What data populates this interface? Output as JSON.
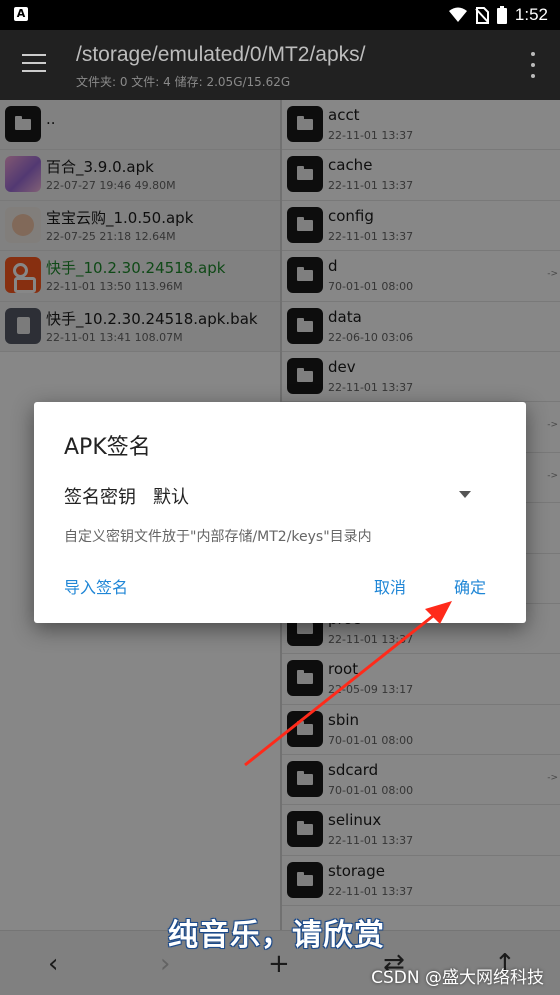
{
  "status_bar": {
    "time": "1:52"
  },
  "toolbar": {
    "path": "/storage/emulated/0/MT2/apks/",
    "stats": "文件夹: 0  文件: 4  储存: 2.05G/15.62G"
  },
  "left_pane": {
    "items": [
      {
        "name": "..",
        "meta": "",
        "icon": "folder-icon"
      },
      {
        "name": "百合_3.9.0.apk",
        "meta": "22-07-27 19:46  49.80M",
        "icon": "baihe-app-icon"
      },
      {
        "name": "宝宝云购_1.0.50.apk",
        "meta": "22-07-25 21:18  12.64M",
        "icon": "baobao-app-icon"
      },
      {
        "name": "快手_10.2.30.24518.apk",
        "meta": "22-11-01 13:50  113.96M",
        "icon": "kuaishou-app-icon"
      },
      {
        "name": "快手_10.2.30.24518.apk.bak",
        "meta": "22-11-01 13:41  108.07M",
        "icon": "file-icon"
      }
    ]
  },
  "right_pane": {
    "items": [
      {
        "name": "acct",
        "meta": "22-11-01 13:37"
      },
      {
        "name": "cache",
        "meta": "22-11-01 13:37"
      },
      {
        "name": "config",
        "meta": "22-11-01 13:37"
      },
      {
        "name": "d",
        "meta": "70-01-01 08:00",
        "link": "->"
      },
      {
        "name": "data",
        "meta": "22-06-10 03:06"
      },
      {
        "name": "dev",
        "meta": "22-11-01 13:37"
      },
      {
        "name": "",
        "meta": "",
        "link": "->"
      },
      {
        "name": "",
        "meta": "",
        "link": "->"
      },
      {
        "name": "",
        "meta": ""
      },
      {
        "name": "",
        "meta": ""
      },
      {
        "name": "proc",
        "meta": "22-11-01 13:37"
      },
      {
        "name": "root",
        "meta": "22-05-09 13:17"
      },
      {
        "name": "sbin",
        "meta": "70-01-01 08:00"
      },
      {
        "name": "sdcard",
        "meta": "70-01-01 08:00",
        "link": "->"
      },
      {
        "name": "selinux",
        "meta": "22-11-01 13:37"
      },
      {
        "name": "storage",
        "meta": "22-11-01 13:37"
      }
    ]
  },
  "dialog": {
    "title": "APK签名",
    "key_label": "签名密钥",
    "key_value": "默认",
    "hint": "自定义密钥文件放于\"内部存储/MT2/keys\"目录内",
    "import_label": "导入签名",
    "cancel_label": "取消",
    "confirm_label": "确定"
  },
  "bottom_bar": {
    "back": "‹",
    "forward": "›",
    "add": "+",
    "swap": "⇄",
    "up": "↑"
  },
  "overlay": {
    "subtitle": "纯音乐，请欣赏",
    "watermark": "CSDN @盛大网络科技"
  },
  "colors": {
    "accent": "#1f86d6",
    "highlight_file": "#1e8b2c",
    "annotation_arrow": "#ff2a1a"
  }
}
